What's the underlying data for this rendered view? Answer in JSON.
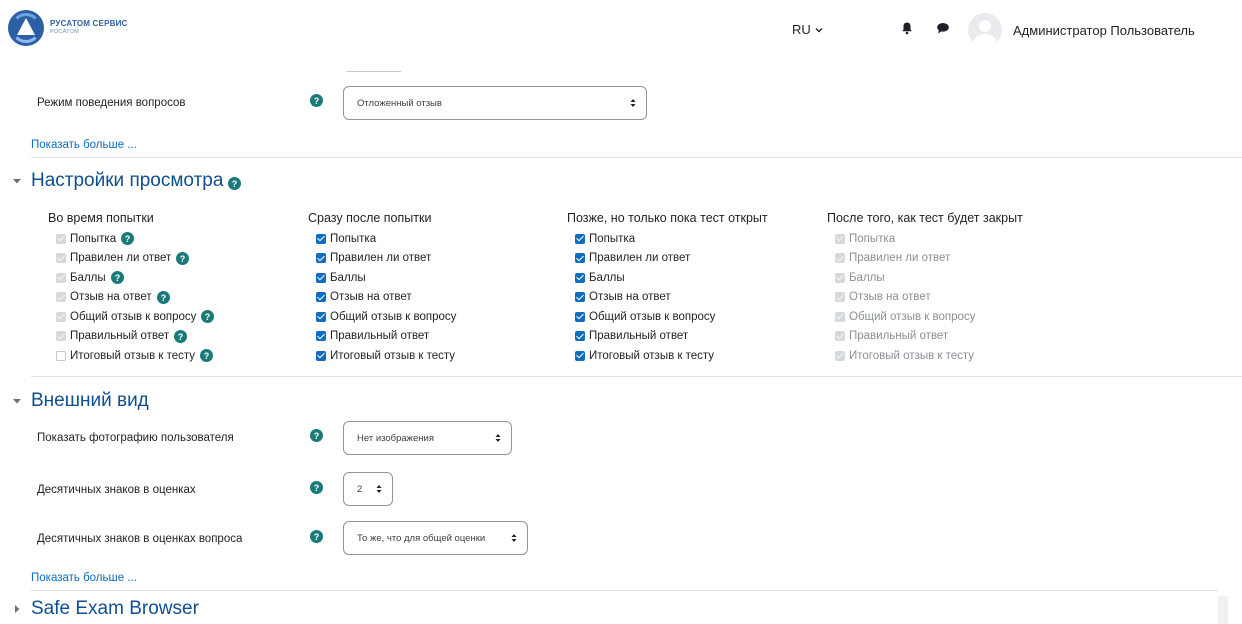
{
  "colors": {
    "link": "#0f6cbf",
    "section": "#0f4f8f",
    "help": "#1a7a7a",
    "checkbox_on": "#0f6cbf",
    "checkbox_disabled": "#d6d9dc"
  },
  "navbar": {
    "logo_title": "РУСАТОМ СЕРВИС",
    "logo_sub": "РОСАТОМ",
    "lang": "RU",
    "icons": [
      "bell-icon",
      "chat-icon"
    ],
    "user_name": "Администратор Пользователь"
  },
  "behaviour": {
    "label": "Режим поведения вопросов",
    "value": "Отложенный отзыв",
    "show_more": "Показать больше ..."
  },
  "review": {
    "title": "Настройки просмотра",
    "columns": [
      {
        "title": "Во время попытки",
        "items": [
          {
            "label": "Попытка",
            "state": "disabled",
            "help": true
          },
          {
            "label": "Правилен ли ответ",
            "state": "disabled",
            "help": true
          },
          {
            "label": "Баллы",
            "state": "disabled",
            "help": true
          },
          {
            "label": "Отзыв на ответ",
            "state": "disabled",
            "help": true
          },
          {
            "label": "Общий отзыв к вопросу",
            "state": "disabled",
            "help": true
          },
          {
            "label": "Правильный ответ",
            "state": "disabled",
            "help": true
          },
          {
            "label": "Итоговый отзыв к тесту",
            "state": "unchecked-disabled",
            "help": true
          }
        ]
      },
      {
        "title": "Сразу после попытки",
        "items": [
          {
            "label": "Попытка",
            "state": "checked"
          },
          {
            "label": "Правилен ли ответ",
            "state": "checked"
          },
          {
            "label": "Баллы",
            "state": "checked"
          },
          {
            "label": "Отзыв на ответ",
            "state": "checked"
          },
          {
            "label": "Общий отзыв к вопросу",
            "state": "checked"
          },
          {
            "label": "Правильный ответ",
            "state": "checked"
          },
          {
            "label": "Итоговый отзыв к тесту",
            "state": "checked"
          }
        ]
      },
      {
        "title": "Позже, но только пока тест открыт",
        "items": [
          {
            "label": "Попытка",
            "state": "checked"
          },
          {
            "label": "Правилен ли ответ",
            "state": "checked"
          },
          {
            "label": "Баллы",
            "state": "checked"
          },
          {
            "label": "Отзыв на ответ",
            "state": "checked"
          },
          {
            "label": "Общий отзыв к вопросу",
            "state": "checked"
          },
          {
            "label": "Правильный ответ",
            "state": "checked"
          },
          {
            "label": "Итоговый отзыв к тесту",
            "state": "checked"
          }
        ]
      },
      {
        "title": "После того, как тест будет закрыт",
        "items": [
          {
            "label": "Попытка",
            "state": "disabled"
          },
          {
            "label": "Правилен ли ответ",
            "state": "disabled"
          },
          {
            "label": "Баллы",
            "state": "disabled"
          },
          {
            "label": "Отзыв на ответ",
            "state": "disabled"
          },
          {
            "label": "Общий отзыв к вопросу",
            "state": "disabled"
          },
          {
            "label": "Правильный ответ",
            "state": "disabled"
          },
          {
            "label": "Итоговый отзыв к тесту",
            "state": "disabled"
          }
        ]
      }
    ]
  },
  "appearance": {
    "title": "Внешний вид",
    "show_photo_label": "Показать фотографию пользователя",
    "show_photo_value": "Нет изображения",
    "decimals_label": "Десятичных знаков в оценках",
    "decimals_value": "2",
    "q_decimals_label": "Десятичных знаков в оценках вопроса",
    "q_decimals_value": "То же, что для общей оценки",
    "show_more": "Показать больше ..."
  },
  "seb": {
    "title": "Safe Exam Browser"
  }
}
